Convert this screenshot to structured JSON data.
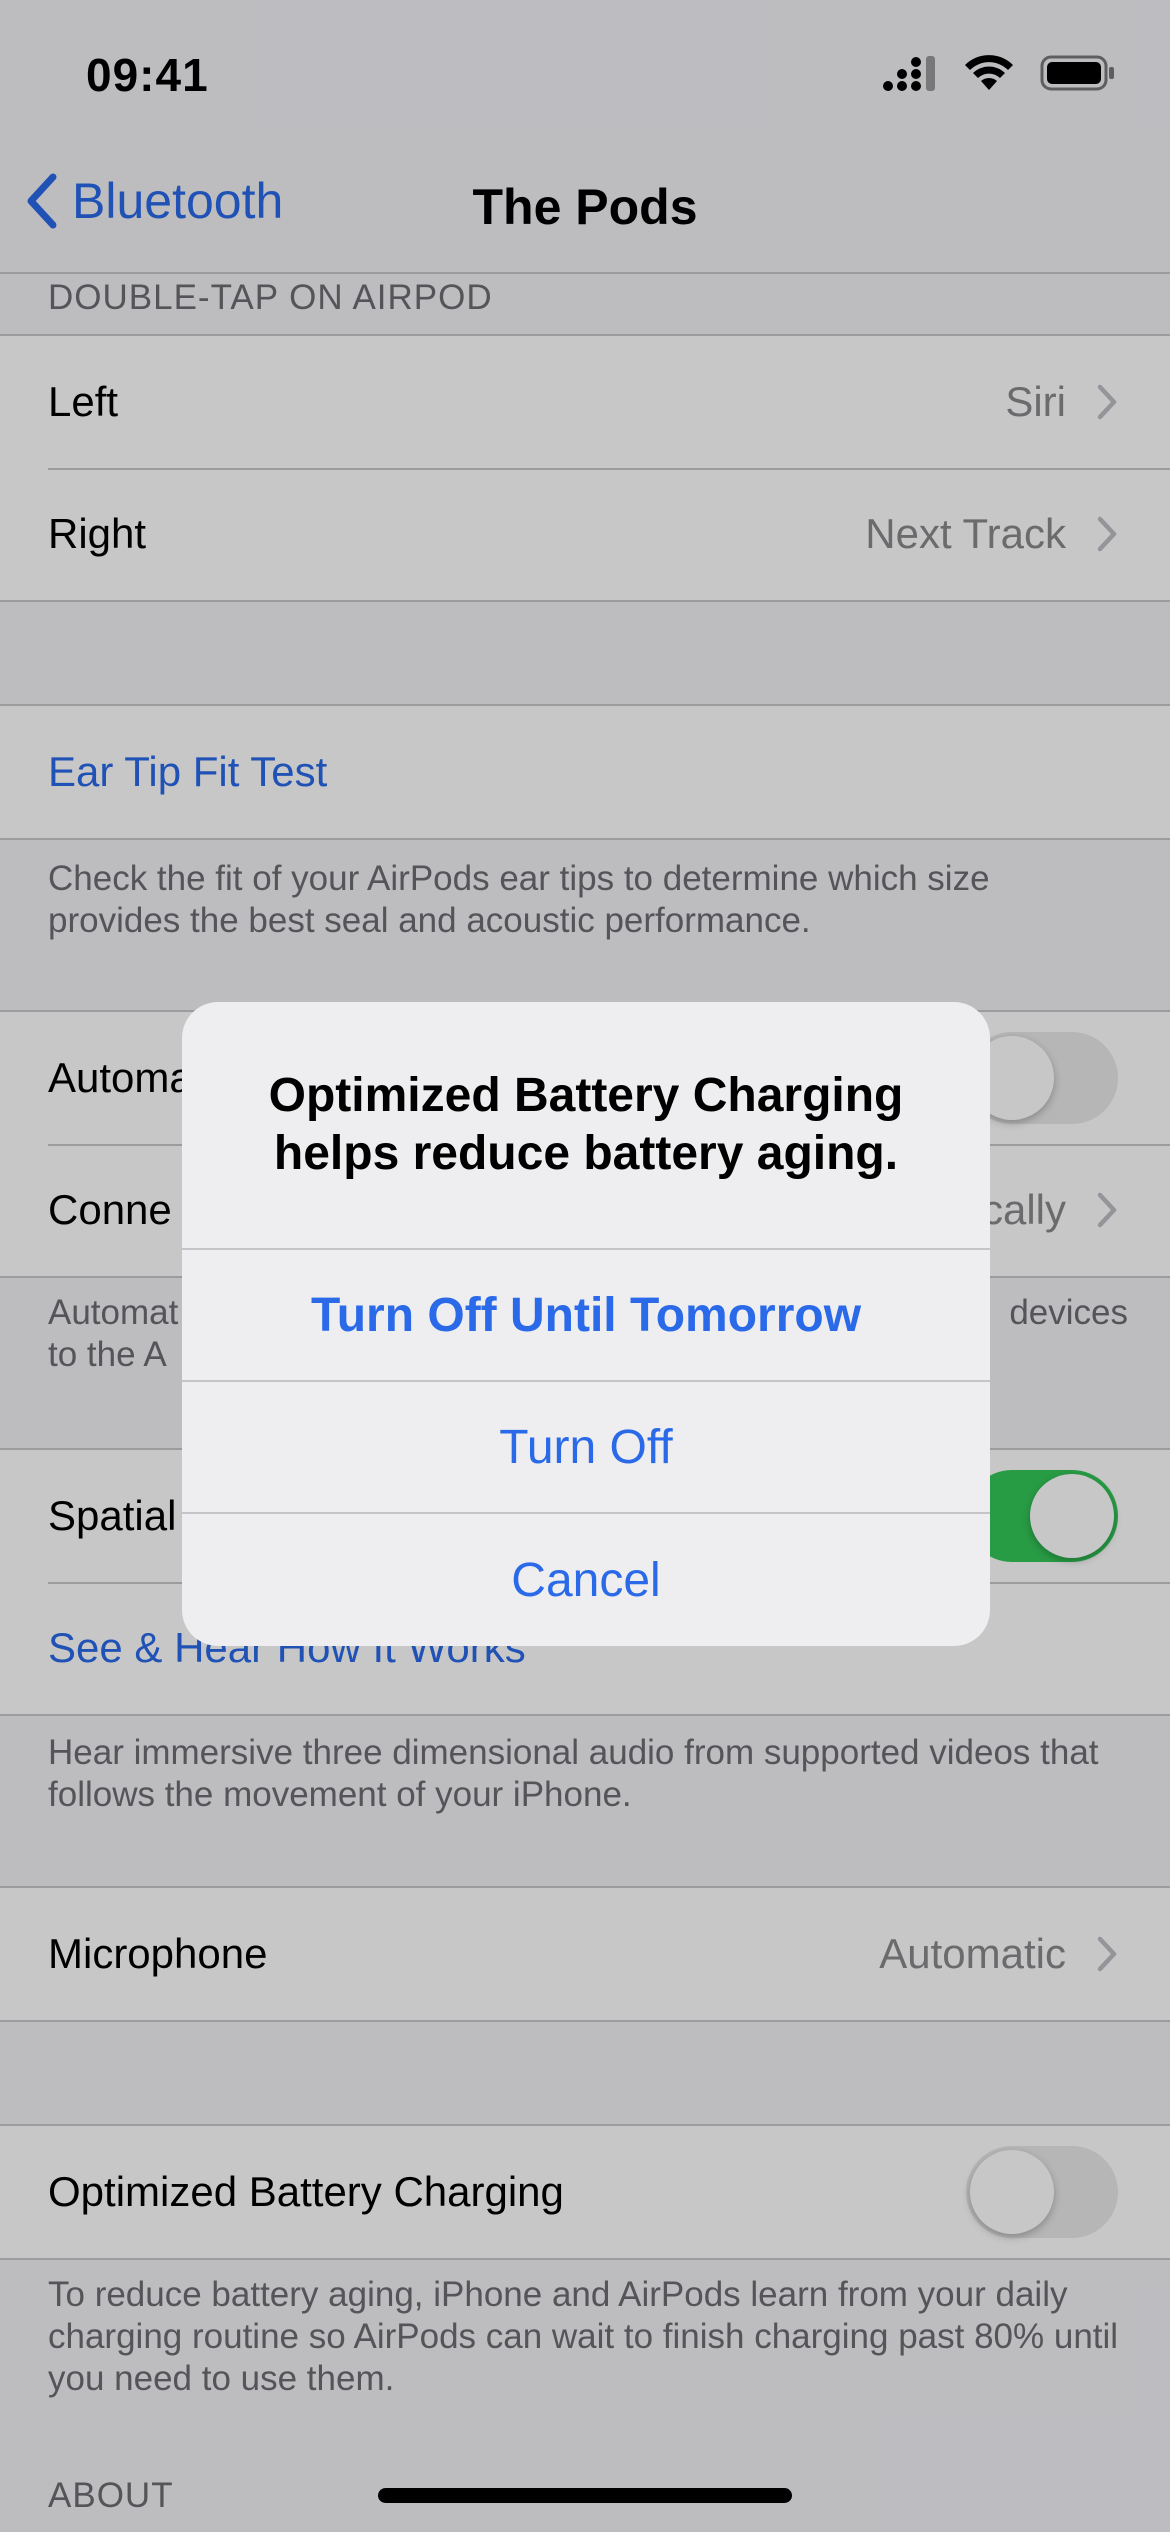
{
  "status": {
    "time": "09:41"
  },
  "nav": {
    "back_label": "Bluetooth",
    "title": "The Pods"
  },
  "double_tap": {
    "header": "DOUBLE-TAP ON AIRPOD",
    "left": {
      "label": "Left",
      "value": "Siri"
    },
    "right": {
      "label": "Right",
      "value": "Next Track"
    }
  },
  "ear_tip": {
    "link": "Ear Tip Fit Test",
    "footer": "Check the fit of your AirPods ear tips to determine which size provides the best seal and acoustic performance."
  },
  "automatic": {
    "ear_detection_label": "Automa",
    "connect_label": "Conne",
    "connect_value": "cally",
    "footer_start": "Automat",
    "footer_end": "devices",
    "footer_line2": "to the A"
  },
  "spatial": {
    "label": "Spatial",
    "link": "See & Hear How It Works",
    "footer": "Hear immersive three dimensional audio from supported videos that follows the movement of your iPhone."
  },
  "microphone": {
    "label": "Microphone",
    "value": "Automatic"
  },
  "battery": {
    "label": "Optimized Battery Charging",
    "footer": "To reduce battery aging, iPhone and AirPods learn from your daily charging routine so AirPods can wait to finish charging past 80% until you need to use them."
  },
  "about": {
    "header": "ABOUT"
  },
  "alert": {
    "title": "Optimized Battery Charging helps reduce battery aging.",
    "btn_until_tomorrow": "Turn Off Until Tomorrow",
    "btn_turn_off": "Turn Off",
    "btn_cancel": "Cancel"
  },
  "colors": {
    "accent": "#2a6ae9",
    "toggle_on": "#34c759"
  }
}
